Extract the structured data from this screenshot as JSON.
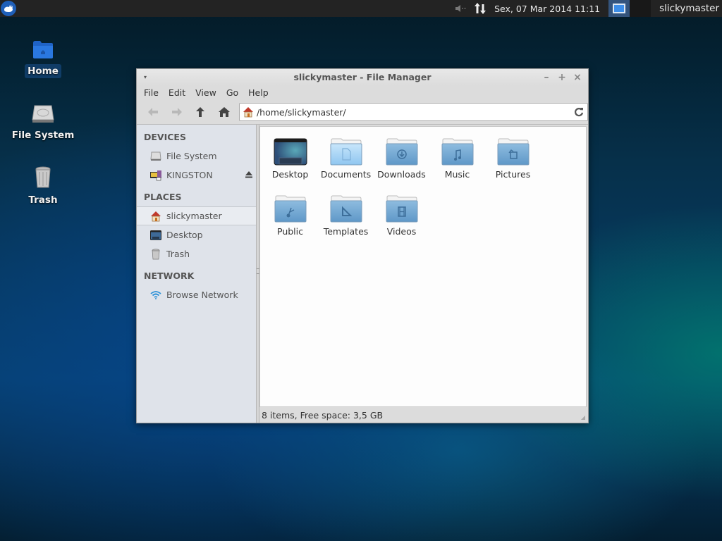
{
  "panel": {
    "menu_icon": "xfce-mouse-icon",
    "volume_icon": "volume-muted-icon",
    "network_icon": "network-transfer-icon",
    "clock": "Sex, 07 Mar 2014 11:11",
    "workspaces": [
      {
        "name": "workspace-1",
        "active": true
      },
      {
        "name": "workspace-2",
        "active": false
      }
    ],
    "user": "slickymaster"
  },
  "desktop": {
    "icons": [
      {
        "label": "Home",
        "icon": "home-folder-icon",
        "selected": true
      },
      {
        "label": "File System",
        "icon": "harddisk-icon",
        "selected": false
      },
      {
        "label": "Trash",
        "icon": "trash-icon",
        "selected": false
      }
    ]
  },
  "window": {
    "title": "slickymaster - File Manager",
    "controls": {
      "menu": "▾",
      "minimize": "–",
      "maximize": "+",
      "close": "×"
    },
    "menu": [
      "File",
      "Edit",
      "View",
      "Go",
      "Help"
    ],
    "toolbar": {
      "back": "back-arrow-icon",
      "forward": "forward-arrow-icon",
      "up": "up-arrow-icon",
      "home": "home-icon"
    },
    "location": "/home/slickymaster/",
    "sidebar": {
      "sections": [
        {
          "title": "DEVICES",
          "items": [
            {
              "label": "File System",
              "icon": "harddisk-icon"
            },
            {
              "label": "KINGSTON",
              "icon": "usb-drive-icon",
              "eject": true
            }
          ]
        },
        {
          "title": "PLACES",
          "items": [
            {
              "label": "slickymaster",
              "icon": "home-icon",
              "selected": true
            },
            {
              "label": "Desktop",
              "icon": "desktop-icon"
            },
            {
              "label": "Trash",
              "icon": "trash-icon"
            }
          ]
        },
        {
          "title": "NETWORK",
          "items": [
            {
              "label": "Browse Network",
              "icon": "wifi-icon"
            }
          ]
        }
      ]
    },
    "files": [
      {
        "name": "Desktop",
        "emblem": "desktop"
      },
      {
        "name": "Documents",
        "emblem": "document"
      },
      {
        "name": "Downloads",
        "emblem": "download"
      },
      {
        "name": "Music",
        "emblem": "music"
      },
      {
        "name": "Pictures",
        "emblem": "pictures"
      },
      {
        "name": "Public",
        "emblem": "share"
      },
      {
        "name": "Templates",
        "emblem": "template"
      },
      {
        "name": "Videos",
        "emblem": "video"
      }
    ],
    "status": "8 items, Free space: 3,5 GB"
  }
}
